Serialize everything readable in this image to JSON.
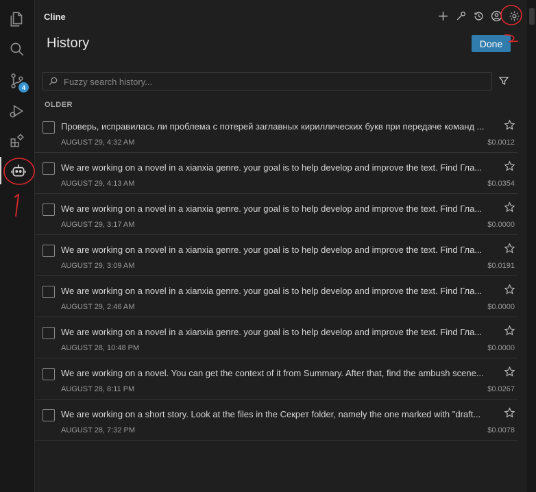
{
  "app_title": "Cline",
  "page_title": "History",
  "done_label": "Done",
  "search": {
    "placeholder": "Fuzzy search history..."
  },
  "section_label": "OLDER",
  "scm_badge": "4",
  "icons": {
    "activity": [
      "explorer-icon",
      "search-icon",
      "source-control-icon",
      "run-debug-icon",
      "extensions-icon",
      "cline-robot-icon"
    ],
    "toolbar": [
      "plus-icon",
      "mcp-server-icon",
      "history-icon",
      "account-icon",
      "settings-icon"
    ]
  },
  "annotations": {
    "number": "1"
  },
  "items": [
    {
      "task": "Проверь, исправилась ли проблема с потерей заглавных кириллических букв при передаче команд ...",
      "date": "AUGUST 29, 4:32 AM",
      "cost": "$0.0012"
    },
    {
      "task": "We are working on a novel in a xianxia genre. your goal is to help develop and improve the text. Find Гла...",
      "date": "AUGUST 29, 4:13 AM",
      "cost": "$0.0354"
    },
    {
      "task": "We are working on a novel in a xianxia genre. your goal is to help develop and improve the text. Find Гла...",
      "date": "AUGUST 29, 3:17 AM",
      "cost": "$0.0000"
    },
    {
      "task": "We are working on a novel in a xianxia genre. your goal is to help develop and improve the text. Find Гла...",
      "date": "AUGUST 29, 3:09 AM",
      "cost": "$0.0191"
    },
    {
      "task": "We are working on a novel in a xianxia genre. your goal is to help develop and improve the text. Find Гла...",
      "date": "AUGUST 29, 2:46 AM",
      "cost": "$0.0000"
    },
    {
      "task": "We are working on a novel in a xianxia genre. your goal is to help develop and improve the text. Find Гла...",
      "date": "AUGUST 28, 10:48 PM",
      "cost": "$0.0000"
    },
    {
      "task": "We are working on a novel. You can get the context of it from Summary. After that, find the ambush scene...",
      "date": "AUGUST 28, 8:11 PM",
      "cost": "$0.0267"
    },
    {
      "task": "We are working on a short story. Look at the files in the Секрет folder, namely the one marked with \"draft...",
      "date": "AUGUST 28, 7:32 PM",
      "cost": "$0.0078"
    }
  ]
}
